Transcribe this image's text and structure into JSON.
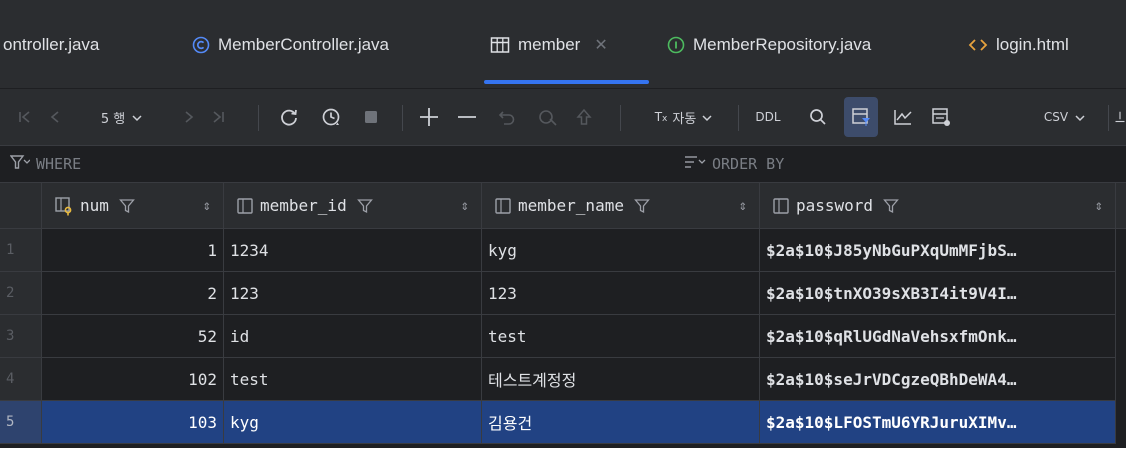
{
  "tabs": [
    {
      "label": "ontroller.java",
      "icon": "none"
    },
    {
      "label": "MemberController.java",
      "icon": "class-icon"
    },
    {
      "label": "member",
      "icon": "table-icon",
      "active": true
    },
    {
      "label": "MemberRepository.java",
      "icon": "interface-icon"
    },
    {
      "label": "login.html",
      "icon": "html-icon"
    }
  ],
  "toolbar": {
    "rows_label": "5 행",
    "tx_label": "자동",
    "ddl_label": "DDL",
    "csv_label": "CSV"
  },
  "filters": {
    "where_label": "WHERE",
    "order_label": "ORDER BY"
  },
  "columns": [
    {
      "name": "num"
    },
    {
      "name": "member_id"
    },
    {
      "name": "member_name"
    },
    {
      "name": "password"
    }
  ],
  "rows": [
    {
      "n": "1",
      "num": "1",
      "member_id": "1234",
      "member_name": "kyg",
      "password": "$2a$10$J85yNbGuPXqUmMFjbS…"
    },
    {
      "n": "2",
      "num": "2",
      "member_id": "123",
      "member_name": "123",
      "password": "$2a$10$tnXO39sXB3I4it9V4I…"
    },
    {
      "n": "3",
      "num": "52",
      "member_id": "id",
      "member_name": "test",
      "password": "$2a$10$qRlUGdNaVehsxfmOnk…"
    },
    {
      "n": "4",
      "num": "102",
      "member_id": "test",
      "member_name": "테스트계정정",
      "password": "$2a$10$seJrVDCgzeQBhDeWA4…"
    },
    {
      "n": "5",
      "num": "103",
      "member_id": "kyg",
      "member_name": "김용건",
      "password": "$2a$10$LFOSTmU6YRJuruXIMv…",
      "selected": true
    }
  ],
  "colors": {
    "accent": "#3574f0",
    "selection": "#214283",
    "background": "#1e1f22",
    "panel": "#2b2d30"
  }
}
